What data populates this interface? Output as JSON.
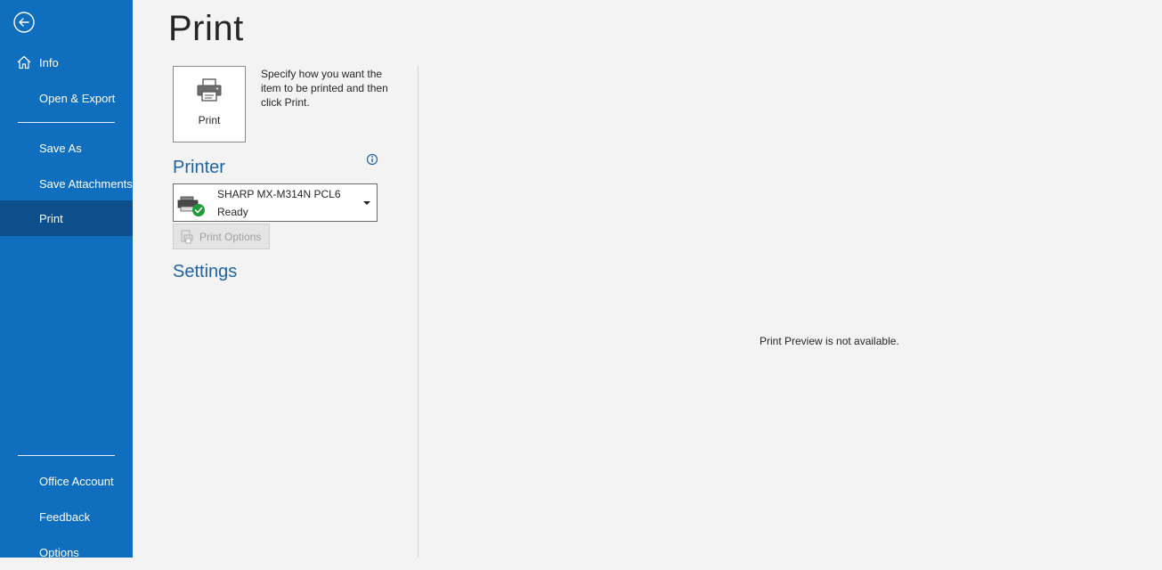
{
  "sidebar": {
    "back_icon": "back-arrow-icon",
    "items": [
      {
        "label": "Info",
        "icon": "home-icon"
      },
      {
        "label": "Open & Export"
      },
      {
        "label": "Save As"
      },
      {
        "label": "Save Attachments"
      },
      {
        "label": "Print",
        "active": true
      },
      {
        "label": "Office Account"
      },
      {
        "label": "Feedback"
      },
      {
        "label": "Options"
      }
    ],
    "colors": {
      "background": "#106ebe",
      "active": "#0c4f8a"
    }
  },
  "main": {
    "title": "Print",
    "print_button": {
      "label": "Print",
      "icon": "printer-icon"
    },
    "description": "Specify how you want the item to be printed and then click Print.",
    "printer_section": {
      "header": "Printer",
      "info_icon": "info-icon",
      "selected_printer": {
        "name": "SHARP MX-M314N PCL6",
        "status": "Ready"
      },
      "print_options_label": "Print Options"
    },
    "settings_section": {
      "header": "Settings"
    },
    "preview_message": "Print Preview is not available.",
    "accent_color": "#1e63a6"
  }
}
